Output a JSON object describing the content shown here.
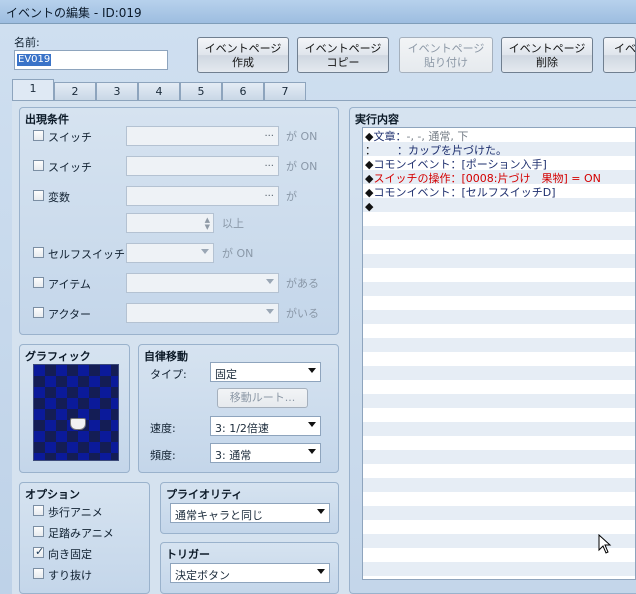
{
  "window": {
    "title": "イベントの編集 - ID:019"
  },
  "name_field": {
    "label": "名前:",
    "value": "EV019"
  },
  "toolbar": {
    "buttons": [
      {
        "label": "イベントページ\n作成",
        "enabled": true
      },
      {
        "label": "イベントページ\nコピー",
        "enabled": true
      },
      {
        "label": "イベントページ\n貼り付け",
        "enabled": false
      },
      {
        "label": "イベントページ\n削除",
        "enabled": true
      },
      {
        "label": "イベ",
        "enabled": true
      }
    ]
  },
  "tabs": [
    "1",
    "2",
    "3",
    "4",
    "5",
    "6",
    "7"
  ],
  "conditions": {
    "title": "出現条件",
    "switch1": {
      "label": "スイッチ",
      "suffix": "が ON",
      "checked": false
    },
    "switch2": {
      "label": "スイッチ",
      "suffix": "が ON",
      "checked": false
    },
    "variable": {
      "label": "変数",
      "suffix": "が",
      "checked": false,
      "spin_suffix": "以上"
    },
    "self_switch": {
      "label": "セルフスイッチ",
      "suffix": "が ON",
      "checked": false
    },
    "item": {
      "label": "アイテム",
      "suffix": "がある",
      "checked": false
    },
    "actor": {
      "label": "アクター",
      "suffix": "がいる",
      "checked": false
    },
    "ellipsis": "..."
  },
  "graphic": {
    "title": "グラフィック"
  },
  "autonomous": {
    "title": "自律移動",
    "type_label": "タイプ:",
    "type_value": "固定",
    "route_button": "移動ルート...",
    "speed_label": "速度:",
    "speed_value": "3: 1/2倍速",
    "freq_label": "頻度:",
    "freq_value": "3: 通常"
  },
  "options": {
    "title": "オプション",
    "items": [
      {
        "label": "歩行アニメ",
        "checked": false
      },
      {
        "label": "足踏みアニメ",
        "checked": false
      },
      {
        "label": "向き固定",
        "checked": true
      },
      {
        "label": "すり抜け",
        "checked": false
      }
    ]
  },
  "priority": {
    "title": "プライオリティ",
    "value": "通常キャラと同じ"
  },
  "trigger": {
    "title": "トリガー",
    "value": "決定ボタン"
  },
  "contents": {
    "title": "実行内容",
    "lines": [
      {
        "prefix": "◆",
        "label": "文章：",
        "text": "-, -, 通常, 下",
        "style": "gray"
      },
      {
        "prefix": "：",
        "label": "      ：",
        "text": "カップを片づけた。",
        "style": "normal"
      },
      {
        "prefix": "◆",
        "label": "コモンイベント：",
        "text": "[ポーション入手]",
        "style": "normal"
      },
      {
        "prefix": "◆",
        "label": "スイッチの操作：",
        "text": "[0008:片づけ　果物] = ON",
        "style": "red"
      },
      {
        "prefix": "◆",
        "label": "コモンイベント：",
        "text": "[セルフスイッチD]",
        "style": "normal"
      },
      {
        "prefix": "◆",
        "label": "",
        "text": "",
        "style": "normal"
      }
    ]
  },
  "icons": {
    "checkmark": "check-icon",
    "dropdown": "chevron-down-icon",
    "cursor": "mouse-pointer-icon"
  }
}
